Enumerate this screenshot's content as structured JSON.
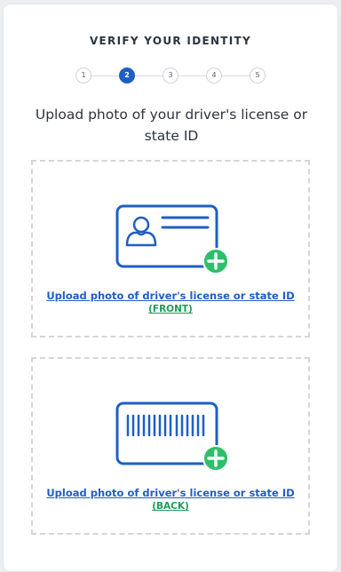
{
  "header": {
    "title": "VERIFY YOUR IDENTITY"
  },
  "stepper": {
    "steps": [
      "1",
      "2",
      "3",
      "4",
      "5"
    ],
    "current_step": 2
  },
  "main": {
    "heading": "Upload photo of your driver's license or state ID"
  },
  "uploads": {
    "front": {
      "icon": "id-card-front-add-icon",
      "link_label": "Upload photo of driver's license or state ID",
      "side_label": "(FRONT)"
    },
    "back": {
      "icon": "id-card-back-barcode-add-icon",
      "link_label": "Upload photo of driver's license or state ID",
      "side_label": "(BACK)"
    }
  },
  "colors": {
    "accent_blue": "#1f5fc4",
    "success_green": "#2fbf6b",
    "side_label_green": "#1f9b57"
  }
}
